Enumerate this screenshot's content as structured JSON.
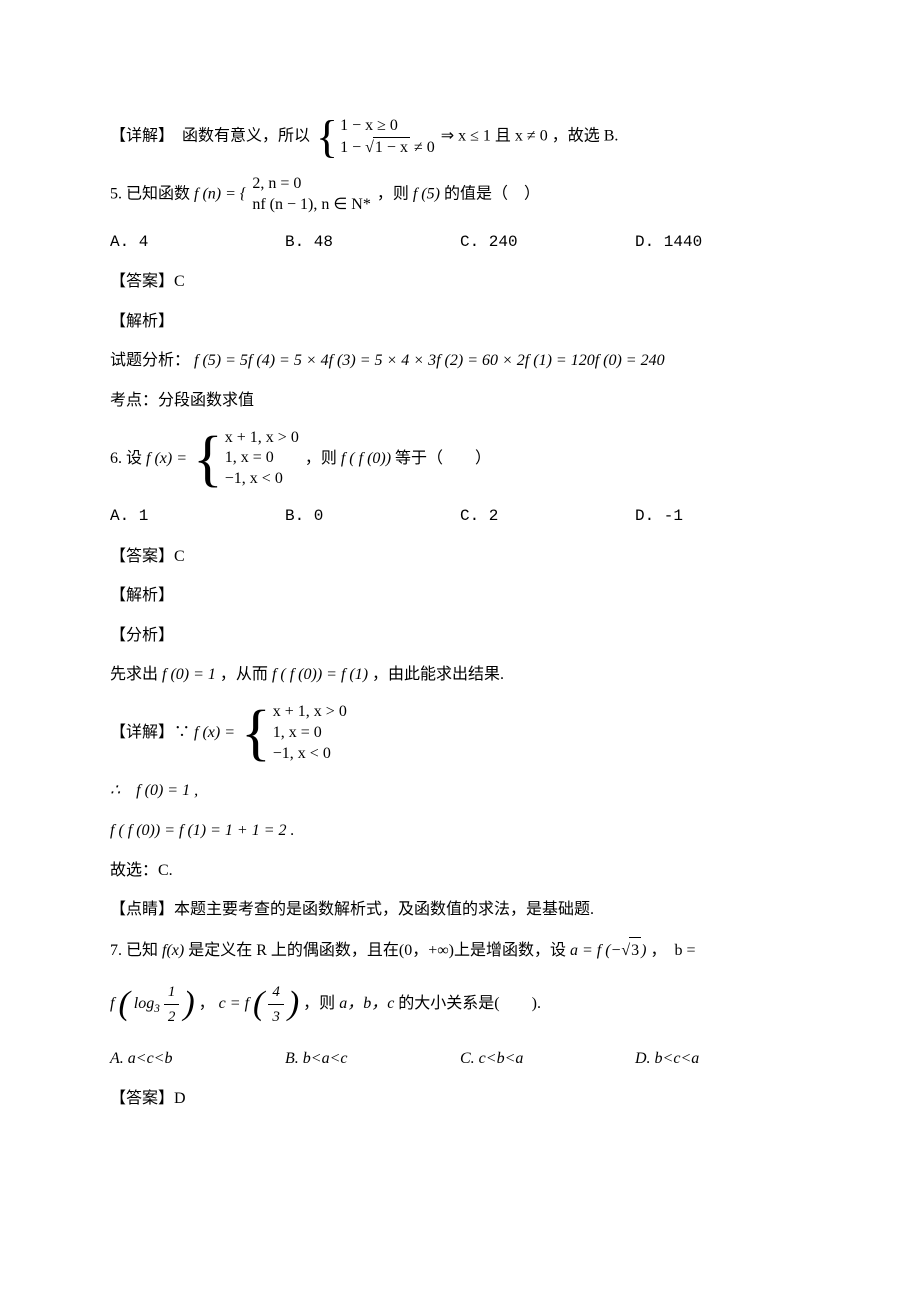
{
  "l1_prefix": "【详解】　函数有意义，所以",
  "l1_case1": "1 − x ≥ 0",
  "l1_case2_a": "1 − √",
  "l1_case2_b": "1 − x",
  "l1_case2_c": " ≠ 0",
  "l1_suffix": " ⇒ x ≤ 1 且 x ≠ 0 ，故选 B.",
  "q5_a": "5. 已知函数 ",
  "q5_b": "f (n) = {",
  "q5_case1": "2, n = 0",
  "q5_case2": "nf (n − 1), n ∈ N*",
  "q5_c": "，则 ",
  "q5_d": "f (5)",
  "q5_e": " 的值是（　）",
  "q5_optA": "A. 4",
  "q5_optB": "B. 48",
  "q5_optC": "C. 240",
  "q5_optD": "D. 1440",
  "q5_ans": "【答案】C",
  "q5_jx": "【解析】",
  "q5_fx": "试题分析：",
  "q5_eq": "f (5) = 5f (4) = 5 × 4f (3) = 5 × 4 × 3f (2) = 60 × 2f (1) = 120f (0) = 240",
  "q5_kd": "考点：分段函数求值",
  "q6_a": "6. 设 ",
  "q6_b": "f (x) =",
  "q6_case1": "x + 1, x > 0",
  "q6_case2": "1, x = 0",
  "q6_case3": "−1, x < 0",
  "q6_c": "，则 ",
  "q6_d": "f ( f (0))",
  "q6_e": " 等于（　　）",
  "q6_optA": "A. 1",
  "q6_optB": "B. 0",
  "q6_optC": "C. 2",
  "q6_optD": "D. -1",
  "q6_ans": "【答案】C",
  "q6_jx": "【解析】",
  "q6_fx": "【分析】",
  "q6_step1a": "先求出 ",
  "q6_step1b": "f (0) = 1",
  "q6_step1c": "，从而 ",
  "q6_step1d": "f ( f (0)) = f (1)",
  "q6_step1e": "，由此能求出结果.",
  "q6_xj_a": "【详解】∵ ",
  "q6_xj_b": "f (x) =",
  "q6_s2": "∴　f (0) = 1 ,",
  "q6_s3": "f ( f (0)) = f (1) = 1 + 1 = 2 .",
  "q6_s4": "故选：C.",
  "q6_ds": "【点睛】本题主要考查的是函数解析式，及函数值的求法，是基础题.",
  "q7_a": "7. 已知",
  "q7_b": " f(x)",
  "q7_c": "是定义在 R 上的偶函数，且在(0，+∞)上是增函数，设",
  "q7_d": " a = f (−√",
  "q7_d2": "3",
  "q7_d3": ")",
  "q7_e": "，　b = ",
  "q7_f_a": "f",
  "q7_f_log": "log",
  "q7_f_3": "3",
  "q7_f_1": "1",
  "q7_f_2": "2",
  "q7_g": "，",
  "q7_h_a": "c = f",
  "q7_h_4": "4",
  "q7_h_3": "3",
  "q7_i": "，则",
  "q7_j": " a，b，c ",
  "q7_k": "的大小关系是(　　).",
  "q7_optA": "A. a<c<b",
  "q7_optB": "B. b<a<c",
  "q7_optC": "C. c<b<a",
  "q7_optD": "D. b<c<a",
  "q7_ans": "【答案】D"
}
